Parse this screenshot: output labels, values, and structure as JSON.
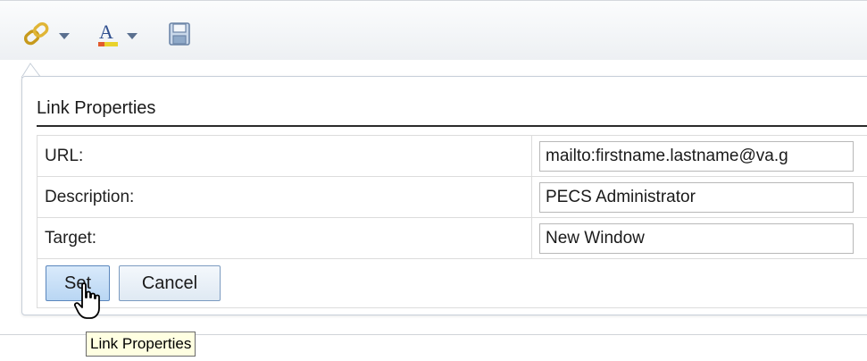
{
  "toolbar": {
    "buttons": [
      {
        "icon": "link-icon",
        "has_dropdown": true
      },
      {
        "icon": "font-color-icon",
        "has_dropdown": true,
        "letter": "A"
      },
      {
        "icon": "save-icon",
        "has_dropdown": false
      }
    ]
  },
  "link_properties": {
    "title": "Link Properties",
    "rows": [
      {
        "label": "URL:",
        "value": "mailto:firstname.lastname@va.g"
      },
      {
        "label": "Description:",
        "value": "PECS Administrator"
      },
      {
        "label": "Target:",
        "value": "New Window"
      }
    ],
    "buttons": {
      "set_label": "Set",
      "cancel_label": "Cancel"
    }
  },
  "tooltip": {
    "text": "Link Properties"
  },
  "colors": {
    "accent_blue": "#5a86bd",
    "tooltip_bg": "#ffffe1",
    "panel_border": "#c7cfd9"
  }
}
